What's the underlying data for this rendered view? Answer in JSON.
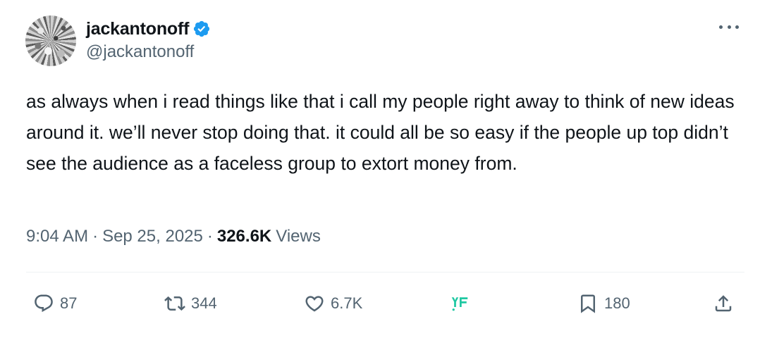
{
  "author": {
    "display_name": "jackantonoff",
    "handle": "@jackantonoff",
    "verified": true,
    "verified_color": "#1d9bf0"
  },
  "tweet": {
    "text": "as always when i read things like that i call my people right away to think of new ideas around it. we’ll never stop doing that. it could all be so easy if the people up top didn’t see the audience as a faceless group to extort money from.",
    "time": "9:04 AM",
    "date": "Sep 25, 2025",
    "separator": "·",
    "views_count": "326.6K",
    "views_label": "Views"
  },
  "actions": {
    "replies": "87",
    "reposts": "344",
    "likes": "6.7K",
    "bookmarks": "180"
  },
  "icons": {
    "reply": "reply-icon",
    "repost": "repost-icon",
    "like": "heart-icon",
    "app": "app-logo-icon",
    "bookmark": "bookmark-icon",
    "share": "share-icon",
    "more": "more-icon"
  },
  "colors": {
    "text": "#0f1419",
    "secondary": "#536471",
    "accent": "#1d9bf0",
    "app_logo": "#1fc8a2"
  }
}
